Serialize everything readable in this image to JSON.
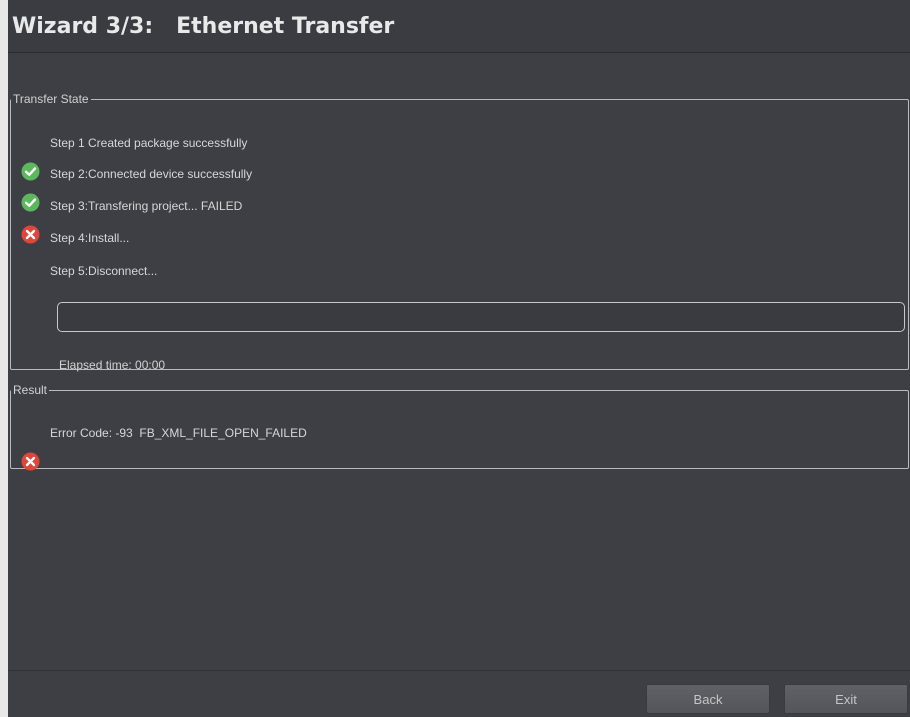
{
  "window": {
    "title": "Wizard 3/3:   Ethernet Transfer"
  },
  "transfer_state": {
    "legend": "Transfer State",
    "steps": [
      {
        "step": "Step 1",
        "text": "Created package successfully",
        "status": "success",
        "icon": "check-circle-icon"
      },
      {
        "step": "Step 2:",
        "text": "Connected device successfully",
        "status": "success",
        "icon": "check-circle-icon"
      },
      {
        "step": "Step 3:",
        "text": "Transfering project... FAILED",
        "status": "failed",
        "icon": "error-circle-icon"
      },
      {
        "step": "Step 4:",
        "text": "Install...",
        "status": "pending",
        "icon": ""
      },
      {
        "step": "Step 5:",
        "text": "Disconnect...",
        "status": "pending",
        "icon": ""
      }
    ],
    "progress_fraction": 0,
    "elapsed_label": "Elapsed time: 00:00"
  },
  "result": {
    "legend": "Result",
    "error_text": "Error Code: -93  FB_XML_FILE_OPEN_FAILED",
    "icon": "error-circle-icon"
  },
  "buttons": {
    "back": "Back",
    "exit": "Exit"
  },
  "colors": {
    "success": "#5cb85c",
    "error": "#e0453a",
    "background": "#3d3f44"
  }
}
